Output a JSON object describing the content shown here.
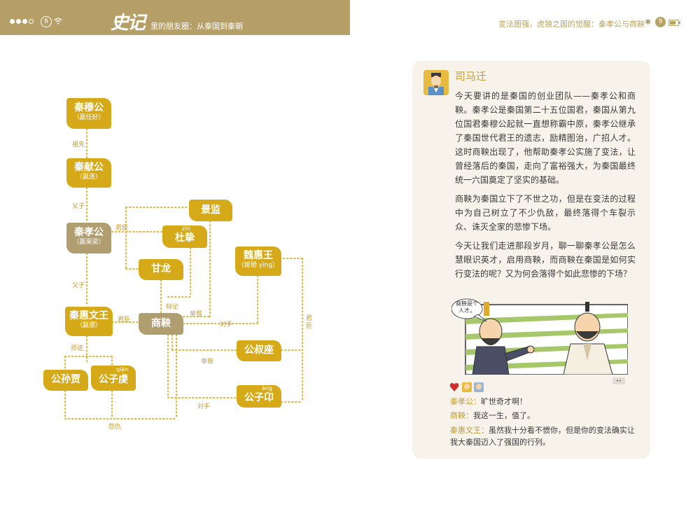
{
  "left_header": {
    "page_number": "8",
    "logo": "史记",
    "title": "里的朋友圈：从秦国到秦朝"
  },
  "right_header": {
    "title": "变法图强，虎狼之国的觉醒：秦孝公与商鞅",
    "page_number": "9"
  },
  "diagram": {
    "nodes": {
      "mugong": {
        "name": "秦穆公",
        "sub": "（嬴任好）"
      },
      "xiangong": {
        "name": "秦献公",
        "sub": "（嬴连）"
      },
      "xiaogong": {
        "name": "秦孝公",
        "sub": "（嬴渠梁）"
      },
      "huiwen": {
        "name": "秦惠文王",
        "sub": "（嬴驷）"
      },
      "shangyang": {
        "name": "商鞅"
      },
      "jingjian": {
        "name": "景监"
      },
      "duzhi": {
        "name": "杜挚",
        "pinyin": "zhì"
      },
      "ganlong": {
        "name": "甘龙"
      },
      "weihui": {
        "name": "魏惠王",
        "sub": "（姬罃 yīng）"
      },
      "gongshuzuo": {
        "name": "公叔座"
      },
      "gongziang": {
        "name": "公子卬",
        "pinyin": "áng"
      },
      "gongsunjia": {
        "name": "公孙贾"
      },
      "gongziqian": {
        "name": "公子虔",
        "pinyin": "qián"
      }
    },
    "relations": {
      "zuxian": "祖先",
      "fuzi1": "父子",
      "fuzi2": "父子",
      "junchen1": "君臣",
      "junchen2": "君臣",
      "junchen3": "君臣",
      "shitu": "师徒",
      "bianlun": "辩论",
      "jujian1": "举荐",
      "jujian2": "举荐",
      "duishou1": "对手",
      "duishou2": "对手",
      "yuanchou": "怨仇"
    }
  },
  "post": {
    "author": "司马迁",
    "paragraphs": [
      "今天要讲的是秦国的创业团队——秦孝公和商鞅。秦孝公是秦国第二十五位国君，秦国从第九位国君秦穆公起就一直想称霸中原，秦孝公继承了秦国世代君王的遗志，励精图治，广招人才。这时商鞅出现了，他帮助秦孝公实施了变法，让曾经落后的秦国，走向了富裕强大，为秦国最终统一六国奠定了坚实的基础。",
      "商鞅为秦国立下了不世之功，但是在变法的过程中为自己树立了不少仇敌，最终落得个车裂示众、诛灭全家的悲惨下场。",
      "今天让我们走进那段岁月，聊一聊秦孝公是怎么慧眼识英才，启用商鞅，而商鞅在秦国是如何实行变法的呢？又为何会落得个如此悲惨的下场？"
    ],
    "speech_bubble": "商鞅是个人才。",
    "like_button": "••",
    "comments": [
      {
        "who": "秦孝公：",
        "text": "旷世奇才啊！"
      },
      {
        "who": "商鞅：",
        "text": "我这一生，值了。"
      },
      {
        "who": "秦惠文王：",
        "text": "虽然我十分看不惯你，但是你的变法确实让我大秦国迈入了强国的行列。"
      }
    ]
  },
  "colors": {
    "header_bg": "#b59f67",
    "node_gold": "#d6a919",
    "node_grey": "#b09d70",
    "accent": "#c49c2e",
    "panel_bg": "#f7f3ea"
  }
}
